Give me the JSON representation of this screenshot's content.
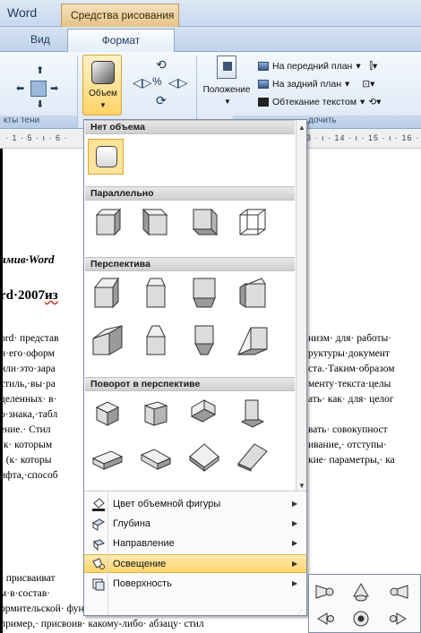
{
  "app": {
    "title_fragment": "Word",
    "context_tab": "Средства рисования",
    "tabs": [
      "Вид",
      "Формат"
    ]
  },
  "ribbon": {
    "group_shadow_footer": "кты тени",
    "volume_button": "Объем",
    "position_button": "Положение",
    "arrange_footer": "дочить",
    "arrange_items": [
      "На передний план",
      "На задний план",
      "Обтекание текстом"
    ]
  },
  "ruler": {
    "left_marks": "· 1 · 5 · ı · 6 ·",
    "right_marks": "3 · ı · 14 · ı · 15 · ı · 16 ·"
  },
  "document": {
    "heading1": "ямив·Word",
    "heading2_plain": "rd·2007",
    "heading2_misspelled": "из",
    "lines": [
      {
        "left": "ord· представ",
        "right": "низм· для· работы·"
      },
      {
        "left": "и·его·оформ",
        "right": "руктуры·документ"
      },
      {
        "left": "или·это·зара",
        "right": "ста.·Таким·образом"
      },
      {
        "left": "стиль,·вы·ра",
        "right": "менту·текста·целы"
      },
      {
        "left": "деленных· в·",
        "right": "ать· как· для· целог"
      },
      {
        "left": "о·знака,·табл",
        "right": ""
      },
      {
        "left": "ение.· Стил",
        "right": "вать· совокупност"
      },
      {
        "left": "(к· которым",
        "right": "ивание,· отступы·"
      },
      {
        "left": "· (к· которы",
        "right": "кие· параметры,· ка"
      },
      {
        "left": "ифта,·способ",
        "right": ""
      }
    ],
    "bottom_lines": [
      {
        "left": "· присваиват",
        "right": ""
      },
      {
        "left": "м·в·состав·",
        "right": ""
      },
      {
        "left": "ормительской· функции· стили· несут· также·",
        "right": ""
      },
      {
        "left": "пример,· присвоив· какому-либо· абзацу· стил",
        "right": ""
      }
    ]
  },
  "menu": {
    "sections": [
      "Нет объема",
      "Параллельно",
      "Перспектива",
      "Поворот в перспективе"
    ],
    "commands": [
      {
        "label": "Цвет объемной фигуры",
        "icon": "paint-bucket-icon"
      },
      {
        "label": "Глубина",
        "icon": "depth-icon"
      },
      {
        "label": "Направление",
        "icon": "direction-icon"
      },
      {
        "label": "Освещение",
        "icon": "lightbulb-icon"
      },
      {
        "label": "Поверхность",
        "icon": "surface-icon"
      }
    ],
    "highlighted_command": "Освещение"
  },
  "submenu": {
    "items": [
      "lighting-top-left",
      "lighting-top",
      "lighting-top-right",
      "lighting-left",
      "lighting-front",
      "lighting-right",
      "lighting-bottom-left",
      "lighting-bottom",
      "lighting-bottom-right"
    ]
  },
  "colors": {
    "accent_highlight": "#ffd46b",
    "ribbon_blue": "#dde8f6",
    "context_tab": "#e7c487"
  }
}
